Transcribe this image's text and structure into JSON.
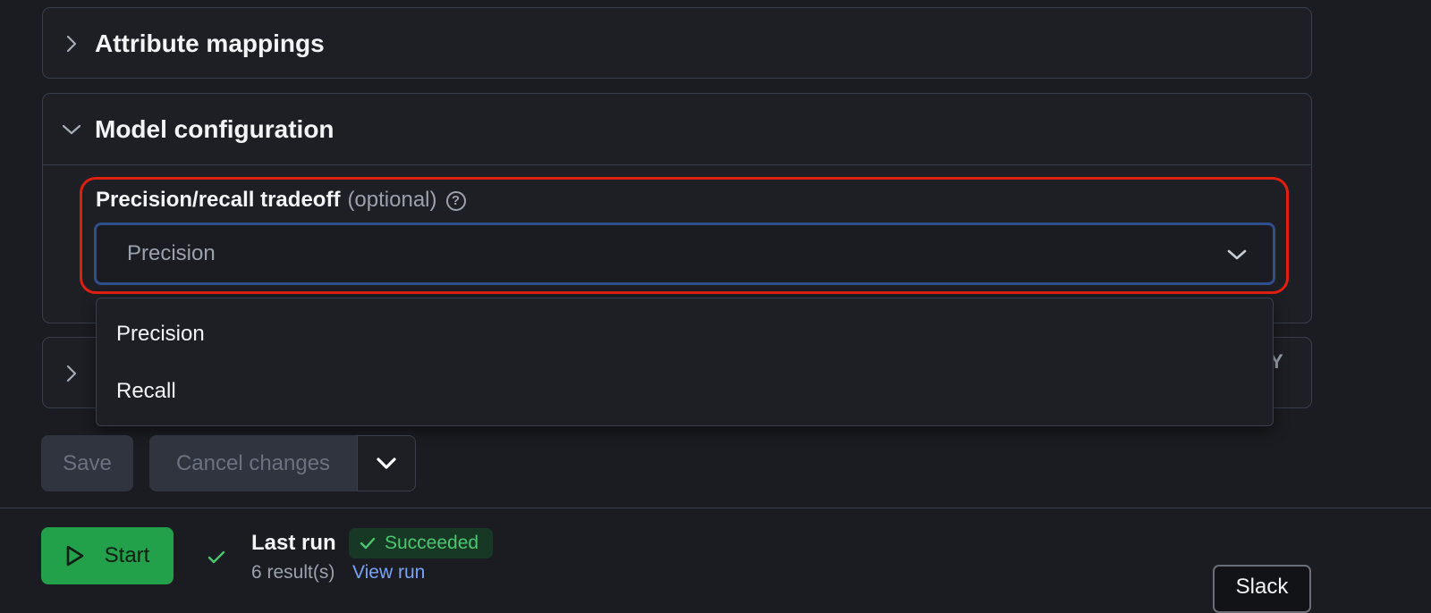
{
  "sections": {
    "attribute_mappings": {
      "title": "Attribute mappings",
      "icon": "chevron-right-icon"
    },
    "model_configuration": {
      "title": "Model configuration",
      "icon": "chevron-down-icon"
    },
    "collapsed_section": {
      "icon": "chevron-right-icon",
      "partial_text": "Y"
    }
  },
  "tradeoff_field": {
    "label": "Precision/recall tradeoff",
    "optional_label": "(optional)",
    "help_icon": "question-circle-icon",
    "selected_value": "Precision",
    "dropdown_icon": "chevron-down-icon",
    "options": [
      "Precision",
      "Recall"
    ]
  },
  "actions": {
    "save_label": "Save",
    "cancel_label": "Cancel changes",
    "more_icon": "chevron-down-icon"
  },
  "footer": {
    "start_label": "Start",
    "start_icon": "play-icon",
    "status_icon": "check-icon",
    "last_run_label": "Last run",
    "status_badge": "Succeeded",
    "results_text": "6 result(s)",
    "view_run_link": "View run",
    "slack_label": "Slack"
  },
  "colors": {
    "background": "#1b1c21",
    "highlight": "#e0200f",
    "focus_border": "#2e4f8a",
    "success": "#22a04a",
    "link": "#7aa2f7"
  }
}
